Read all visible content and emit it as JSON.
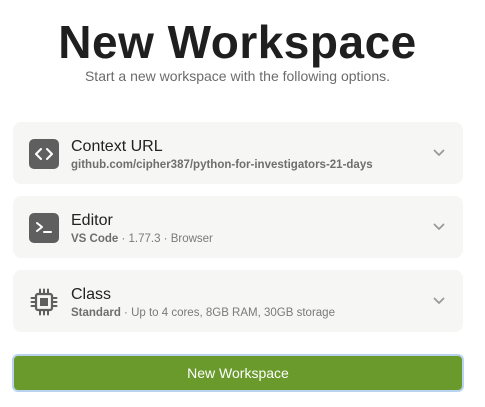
{
  "header": {
    "title": "New Workspace",
    "subtitle": "Start a new workspace with the following options."
  },
  "options": [
    {
      "title": "Context URL",
      "value": "github.com/cipher387/python-for-investigators-21-days",
      "detail": "",
      "icon": "code-brackets-icon"
    },
    {
      "title": "Editor",
      "value": "VS Code",
      "detail": " · 1.77.3 · Browser",
      "icon": "terminal-icon"
    },
    {
      "title": "Class",
      "value": "Standard",
      "detail": " · Up to 4 cores, 8GB RAM, 30GB storage",
      "icon": "cpu-chip-icon"
    }
  ],
  "actions": {
    "create_label": "New Workspace"
  },
  "colors": {
    "accent": "#6a9a2c",
    "card_bg": "#f6f6f5",
    "icon_bg": "#5f5f5f"
  }
}
